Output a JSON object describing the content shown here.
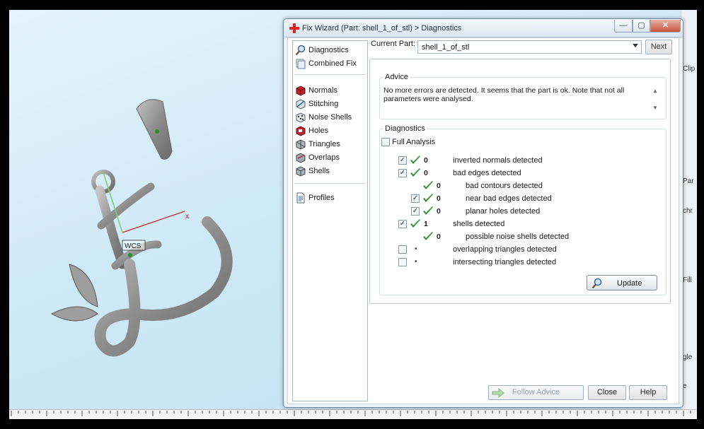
{
  "dialog": {
    "title": "Fix Wizard (Part: shell_1_of_stl) > Diagnostics",
    "window_buttons": {
      "minimize": "—",
      "maximize": "▢",
      "close": "✕"
    }
  },
  "nav": {
    "top_items": [
      {
        "label": "Diagnostics",
        "icon": "magnifier-icon",
        "selected": true
      },
      {
        "label": "Combined Fix",
        "icon": "stacked-pages-icon"
      }
    ],
    "fix_items": [
      {
        "label": "Normals",
        "icon": "red-cube-icon"
      },
      {
        "label": "Stitching",
        "icon": "stitch-icon"
      },
      {
        "label": "Noise Shells",
        "icon": "dots-cube-icon"
      },
      {
        "label": "Holes",
        "icon": "hole-cube-icon"
      },
      {
        "label": "Triangles",
        "icon": "triangles-icon"
      },
      {
        "label": "Overlaps",
        "icon": "overlap-icon"
      },
      {
        "label": "Shells",
        "icon": "shells-icon"
      }
    ],
    "bottom_items": [
      {
        "label": "Profiles",
        "icon": "document-icon"
      }
    ]
  },
  "current_part": {
    "label": "Current Part:",
    "value": "shell_1_of_stl",
    "next_label": "Next"
  },
  "advice": {
    "title": "Advice",
    "text": "No more errors are detected. It seems that the part is ok. Note that not all parameters were analysed."
  },
  "diagnostics": {
    "title": "Diagnostics",
    "full_analysis_label": "Full Analysis",
    "full_analysis_checked": false,
    "rows": [
      {
        "checked": true,
        "status": "ok",
        "count": "0",
        "label": "inverted normals detected",
        "indent": 0
      },
      {
        "checked": true,
        "status": "ok",
        "count": "0",
        "label": "bad edges detected",
        "indent": 0
      },
      {
        "checked": null,
        "status": "ok",
        "count": "0",
        "label": "bad contours detected",
        "indent": 1
      },
      {
        "checked": true,
        "status": "ok",
        "count": "0",
        "label": "near bad edges detected",
        "indent": 1
      },
      {
        "checked": true,
        "status": "ok",
        "count": "0",
        "label": "planar holes detected",
        "indent": 1
      },
      {
        "checked": true,
        "status": "ok",
        "count": "1",
        "label": "shells detected",
        "indent": 0
      },
      {
        "checked": null,
        "status": "ok",
        "count": "0",
        "label": "possible noise shells detected",
        "indent": 1
      },
      {
        "checked": false,
        "status": "na",
        "count": "•",
        "label": "overlapping triangles detected",
        "indent": 0
      },
      {
        "checked": false,
        "status": "na",
        "count": "•",
        "label": "intersecting triangles detected",
        "indent": 0
      }
    ],
    "update_label": "Update"
  },
  "buttons": {
    "follow_advice": "Follow Advice",
    "close": "Close",
    "help": "Help"
  },
  "viewport": {
    "wcs_label": "WCS",
    "axis_x_label": "x",
    "right_strip": [
      "Clip",
      "Par",
      "chr",
      "Fill",
      "gle",
      "e"
    ]
  },
  "colors": {
    "check_green": "#2f8f2f",
    "background_blue": "#cfe9f6",
    "model_gray": "#9a9a9a",
    "accent_red": "#cc2222"
  }
}
